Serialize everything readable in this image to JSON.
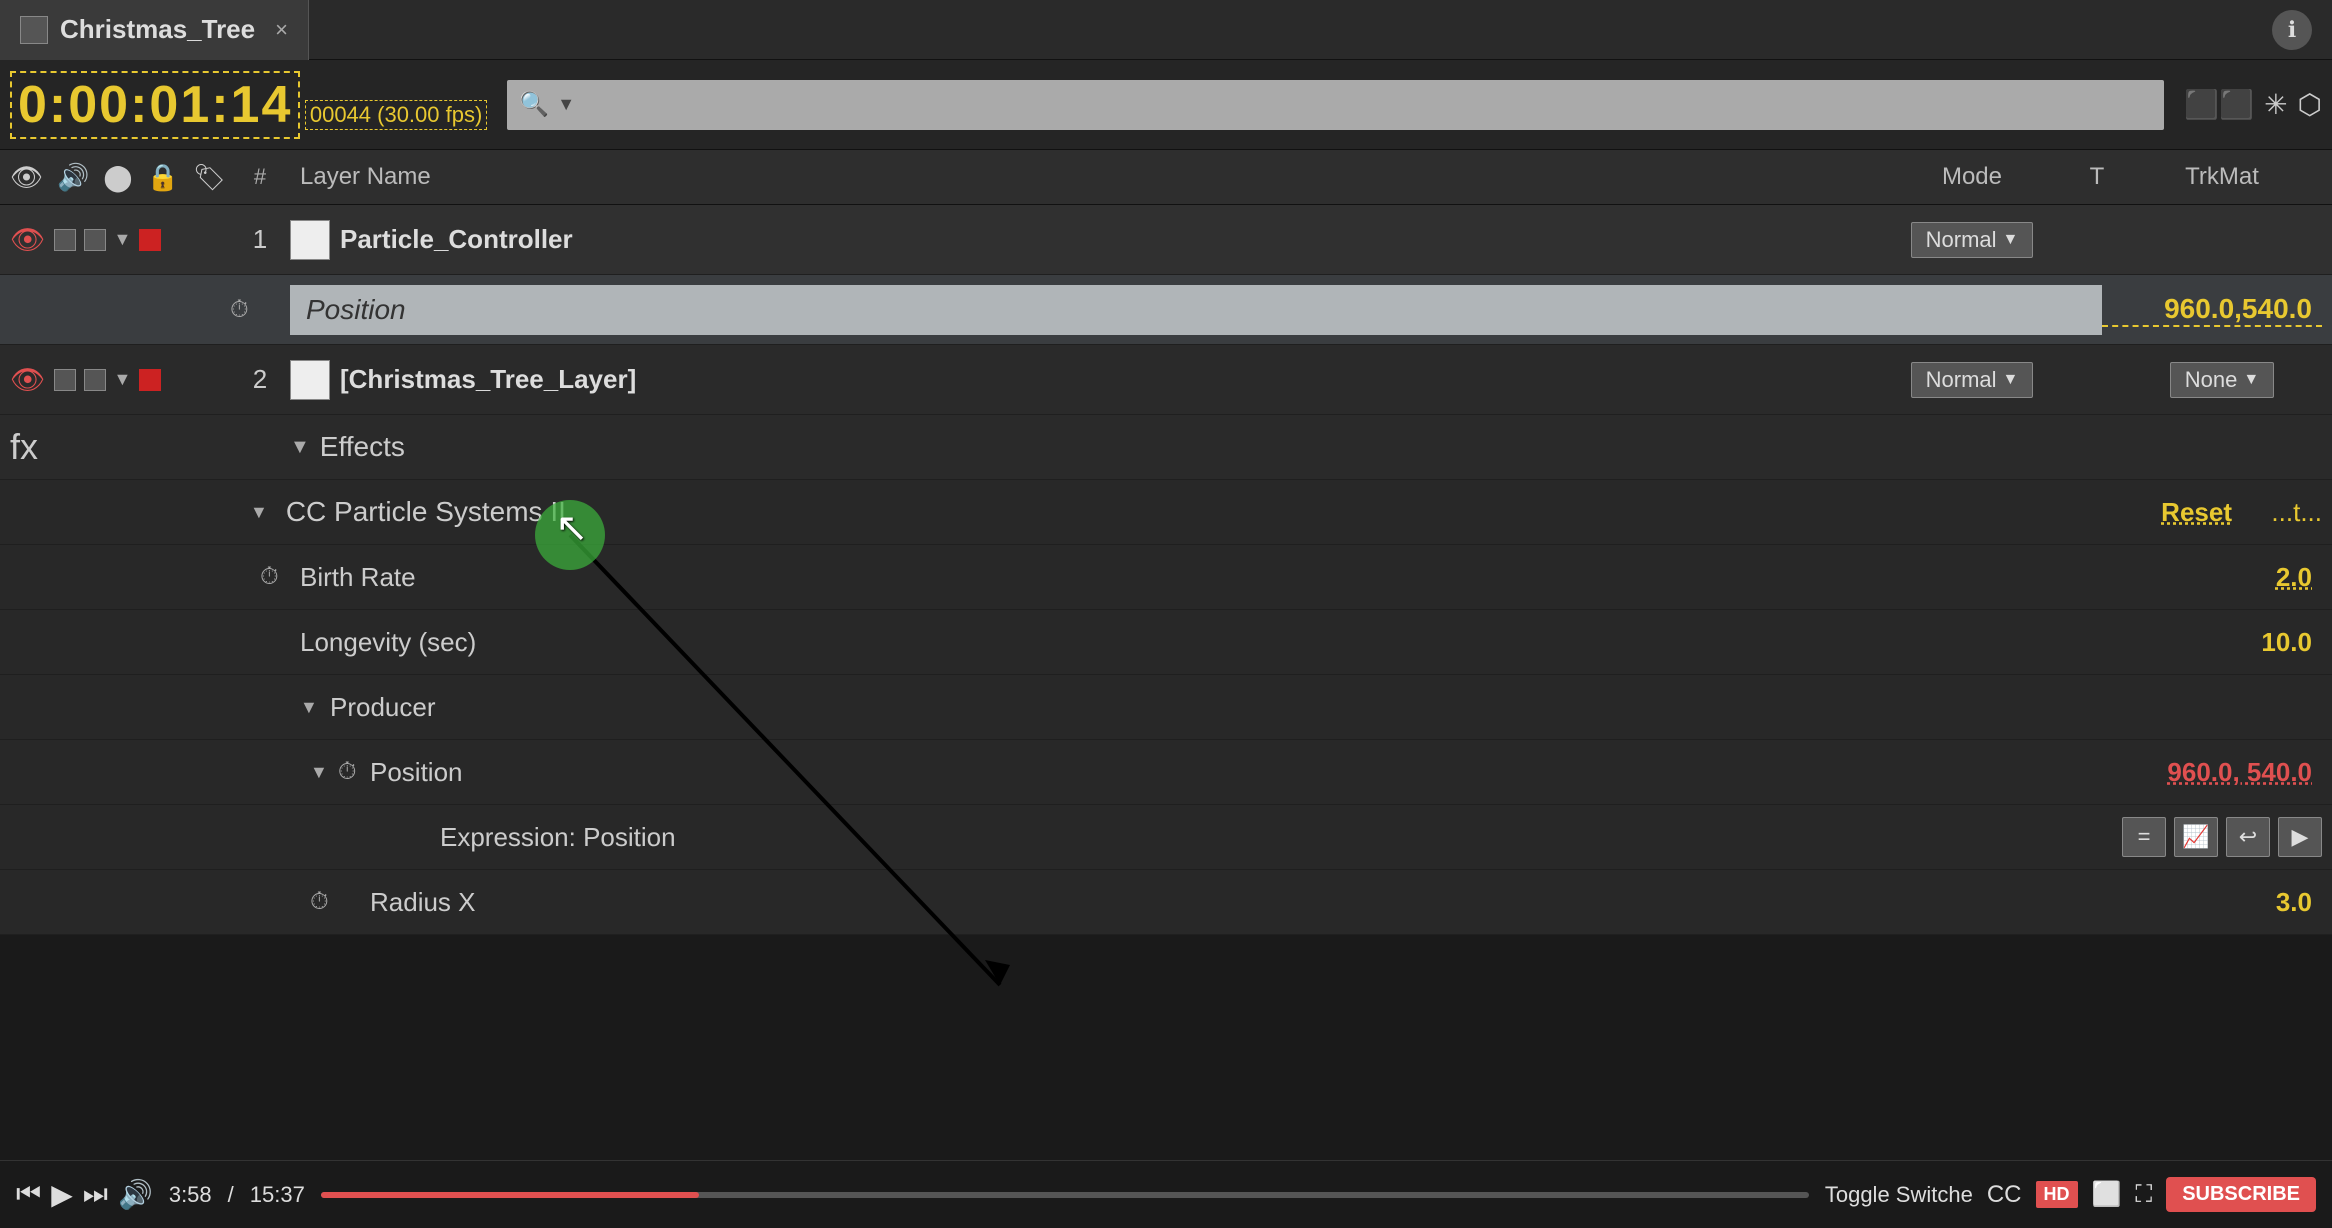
{
  "tab": {
    "title": "Christmas_Tree",
    "close_label": "×",
    "icon_label": "comp-icon"
  },
  "timecode": {
    "display": "0:00:01:14",
    "frame_info": "00044 (30.00 fps)"
  },
  "search": {
    "placeholder": ""
  },
  "header": {
    "hash": "#",
    "layer_name": "Layer Name",
    "mode": "Mode",
    "t": "T",
    "trkmat": "TrkMat"
  },
  "layer1": {
    "number": "1",
    "name": "Particle_Controller",
    "mode": "Normal",
    "position_label": "Position",
    "position_value": "960.0,540.0"
  },
  "layer2": {
    "number": "2",
    "name": "[Christmas_Tree_Layer]",
    "mode": "Normal",
    "trkmat": "None"
  },
  "effects": {
    "label": "Effects",
    "fx_section": "CC Particle Systems II",
    "reset_label": "Reset",
    "ellipsis": "...t...",
    "birth_rate_label": "Birth Rate",
    "birth_rate_value": "2.0",
    "longevity_label": "Longevity (sec)",
    "longevity_value": "10.0",
    "producer_label": "Producer",
    "position_label": "Position",
    "position_value": "960.0, 540.0",
    "expression_label": "Expression: Position",
    "radius_x_label": "Radius X",
    "radius_x_value": "3.0"
  },
  "video_player": {
    "current_time": "3:58",
    "total_time": "15:37",
    "toggle_label": "Toggle Switche",
    "subscribe_label": "SUBSCRIBE"
  },
  "info_icon_label": "ℹ"
}
